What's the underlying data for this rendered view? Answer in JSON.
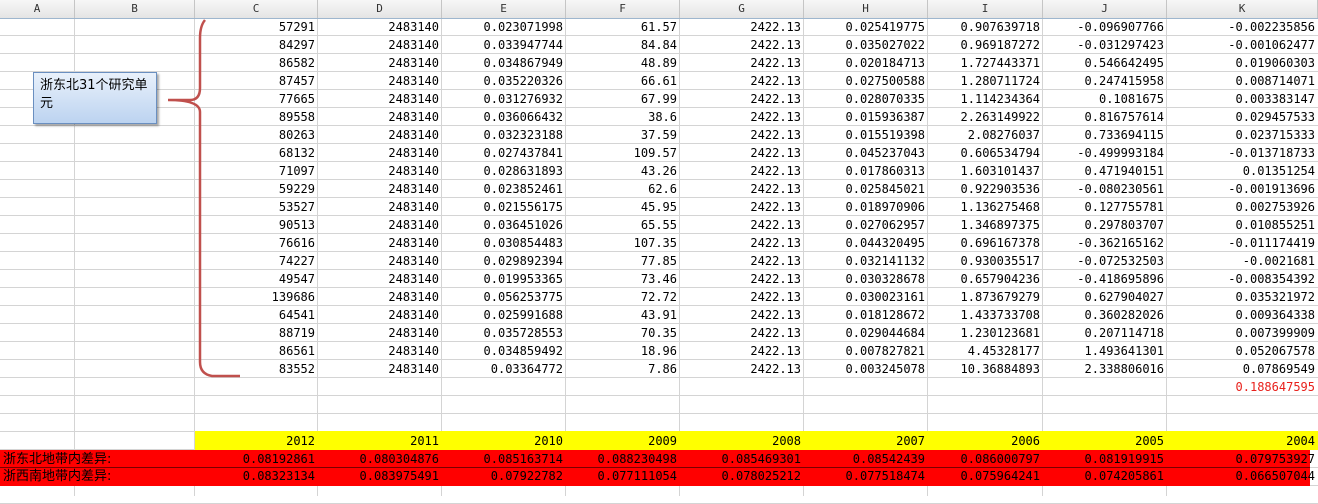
{
  "columns": [
    "A",
    "B",
    "C",
    "D",
    "E",
    "F",
    "G",
    "H",
    "I",
    "J",
    "K"
  ],
  "rows": [
    [
      "57291",
      "2483140",
      "0.023071998",
      "61.57",
      "2422.13",
      "0.025419775",
      "0.907639718",
      "-0.096907766",
      "-0.002235856"
    ],
    [
      "84297",
      "2483140",
      "0.033947744",
      "84.84",
      "2422.13",
      "0.035027022",
      "0.969187272",
      "-0.031297423",
      "-0.001062477"
    ],
    [
      "86582",
      "2483140",
      "0.034867949",
      "48.89",
      "2422.13",
      "0.020184713",
      "1.727443371",
      "0.546642495",
      "0.019060303"
    ],
    [
      "87457",
      "2483140",
      "0.035220326",
      "66.61",
      "2422.13",
      "0.027500588",
      "1.280711724",
      "0.247415958",
      "0.008714071"
    ],
    [
      "77665",
      "2483140",
      "0.031276932",
      "67.99",
      "2422.13",
      "0.028070335",
      "1.114234364",
      "0.1081675",
      "0.003383147"
    ],
    [
      "89558",
      "2483140",
      "0.036066432",
      "38.6",
      "2422.13",
      "0.015936387",
      "2.263149922",
      "0.816757614",
      "0.029457533"
    ],
    [
      "80263",
      "2483140",
      "0.032323188",
      "37.59",
      "2422.13",
      "0.015519398",
      "2.08276037",
      "0.733694115",
      "0.023715333"
    ],
    [
      "68132",
      "2483140",
      "0.027437841",
      "109.57",
      "2422.13",
      "0.045237043",
      "0.606534794",
      "-0.499993184",
      "-0.013718733"
    ],
    [
      "71097",
      "2483140",
      "0.028631893",
      "43.26",
      "2422.13",
      "0.017860313",
      "1.603101437",
      "0.471940151",
      "0.01351254"
    ],
    [
      "59229",
      "2483140",
      "0.023852461",
      "62.6",
      "2422.13",
      "0.025845021",
      "0.922903536",
      "-0.080230561",
      "-0.001913696"
    ],
    [
      "53527",
      "2483140",
      "0.021556175",
      "45.95",
      "2422.13",
      "0.018970906",
      "1.136275468",
      "0.127755781",
      "0.002753926"
    ],
    [
      "90513",
      "2483140",
      "0.036451026",
      "65.55",
      "2422.13",
      "0.027062957",
      "1.346897375",
      "0.297803707",
      "0.010855251"
    ],
    [
      "76616",
      "2483140",
      "0.030854483",
      "107.35",
      "2422.13",
      "0.044320495",
      "0.696167378",
      "-0.362165162",
      "-0.011174419"
    ],
    [
      "74227",
      "2483140",
      "0.029892394",
      "77.85",
      "2422.13",
      "0.032141132",
      "0.930035517",
      "-0.072532503",
      "-0.0021681"
    ],
    [
      "49547",
      "2483140",
      "0.019953365",
      "73.46",
      "2422.13",
      "0.030328678",
      "0.657904236",
      "-0.418695896",
      "-0.008354392"
    ],
    [
      "139686",
      "2483140",
      "0.056253775",
      "72.72",
      "2422.13",
      "0.030023161",
      "1.873679279",
      "0.627904027",
      "0.035321972"
    ],
    [
      "64541",
      "2483140",
      "0.025991688",
      "43.91",
      "2422.13",
      "0.018128672",
      "1.433733708",
      "0.360282026",
      "0.009364338"
    ],
    [
      "88719",
      "2483140",
      "0.035728553",
      "70.35",
      "2422.13",
      "0.029044684",
      "1.230123681",
      "0.207114718",
      "0.007399909"
    ],
    [
      "86561",
      "2483140",
      "0.034859492",
      "18.96",
      "2422.13",
      "0.007827821",
      "4.45328177",
      "1.493641301",
      "0.052067578"
    ],
    [
      "83552",
      "2483140",
      "0.03364772",
      "7.86",
      "2422.13",
      "0.003245078",
      "10.36884893",
      "2.338806016",
      "0.07869549"
    ]
  ],
  "total_value": "0.188647595",
  "note_text": "浙东北31个研究单元",
  "years": [
    "2012",
    "2011",
    "2010",
    "2009",
    "2008",
    "2007",
    "2006",
    "2005",
    "2004"
  ],
  "summary_rows": [
    {
      "label": "浙东北地带内差异:",
      "values": [
        "0.08192861",
        "0.080304876",
        "0.085163714",
        "0.088230498",
        "0.085469301",
        "0.08542439",
        "0.086000797",
        "0.081919915",
        "0.079753927"
      ]
    },
    {
      "label": "浙西南地带内差异:",
      "values": [
        "0.08323134",
        "0.083975491",
        "0.07922782",
        "0.077111054",
        "0.078025212",
        "0.077518474",
        "0.075964241",
        "0.074205861",
        "0.066507044"
      ]
    }
  ],
  "colors": {
    "highlight_yellow": "#ffff00",
    "highlight_red": "#ff0000",
    "total_text": "#e8201b"
  }
}
